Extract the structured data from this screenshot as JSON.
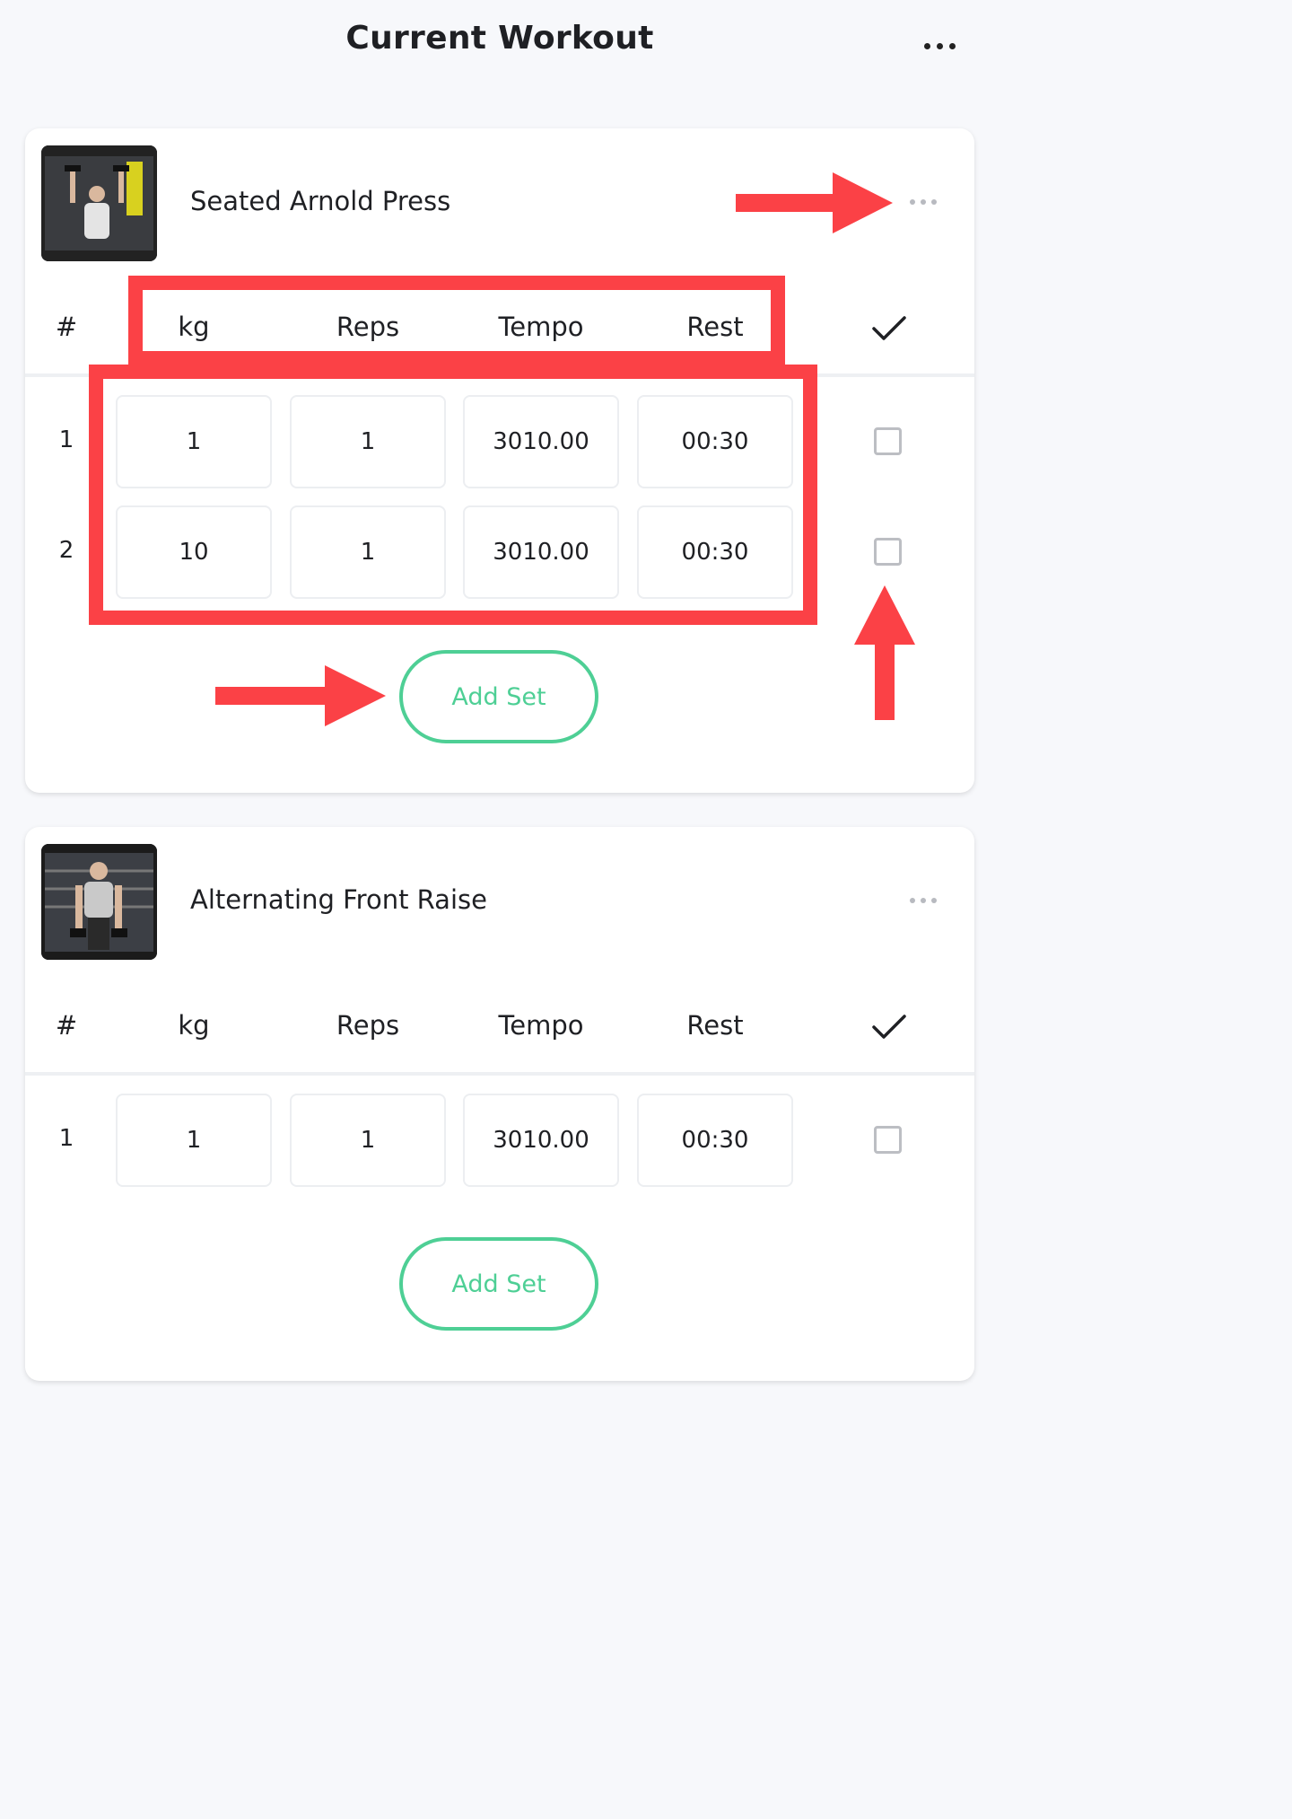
{
  "header": {
    "title": "Current Workout"
  },
  "columns": {
    "number": "#",
    "kg": "kg",
    "reps": "Reps",
    "tempo": "Tempo",
    "rest": "Rest"
  },
  "exercises": [
    {
      "name": "Seated Arnold Press",
      "sets": [
        {
          "number": "1",
          "kg": "1",
          "reps": "1",
          "tempo": "3010.00",
          "rest": "00:30"
        },
        {
          "number": "2",
          "kg": "10",
          "reps": "1",
          "tempo": "3010.00",
          "rest": "00:30"
        }
      ],
      "add_label": "Add Set"
    },
    {
      "name": "Alternating Front Raise",
      "sets": [
        {
          "number": "1",
          "kg": "1",
          "reps": "1",
          "tempo": "3010.00",
          "rest": "00:30"
        }
      ],
      "add_label": "Add Set"
    }
  ],
  "colors": {
    "accent": "#4ecf95",
    "annotation": "#fb4146"
  }
}
